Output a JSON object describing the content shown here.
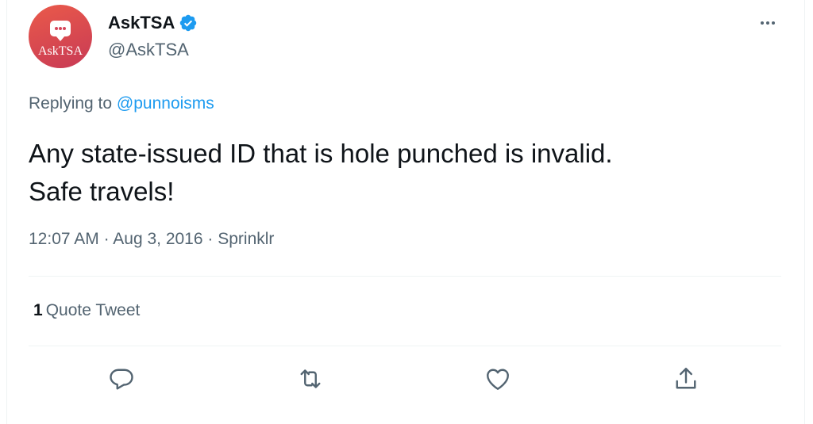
{
  "author": {
    "display_name": "AskTSA",
    "handle": "@AskTSA",
    "avatar_text": "AskTSA",
    "avatar_colors": [
      "#ea5a4a",
      "#c83a55"
    ],
    "verified_color": "#1d9bf0"
  },
  "reply": {
    "prefix": "Replying to",
    "mention": "@punnoisms"
  },
  "tweet": {
    "text": "Any state-issued ID that is hole punched is invalid.\nSafe travels!"
  },
  "meta": {
    "time": "12:07 AM",
    "sep1": "·",
    "date": "Aug 3, 2016",
    "sep2": "·",
    "source": "Sprinklr"
  },
  "stats": {
    "quote_count": "1",
    "quote_label": "Quote Tweet"
  },
  "actions": {
    "icons": [
      "reply-icon",
      "retweet-icon",
      "like-icon",
      "share-icon"
    ]
  },
  "colors": {
    "accent": "#1d9bf0",
    "text": "#0f1419",
    "muted": "#536471",
    "divider": "#eff3f4"
  }
}
